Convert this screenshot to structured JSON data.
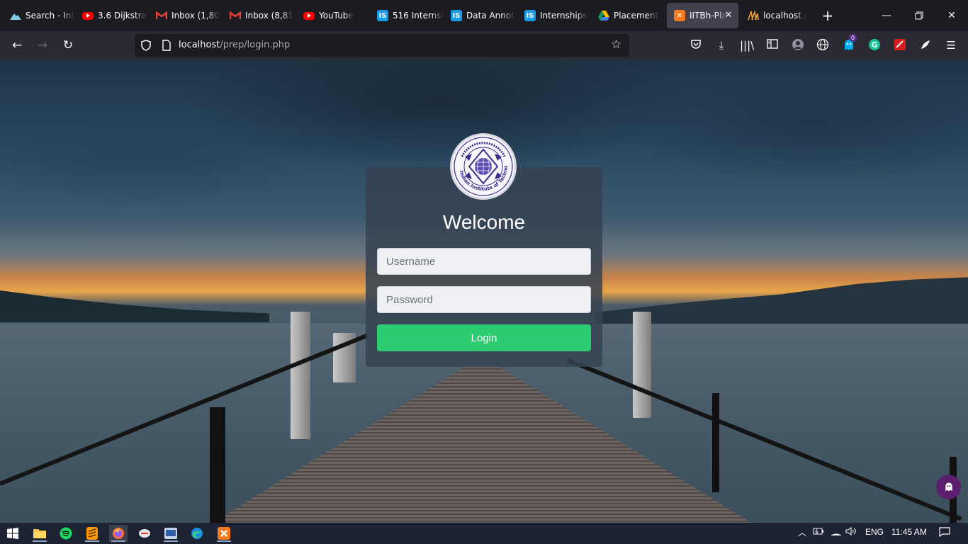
{
  "browser": {
    "tabs": [
      {
        "label": "Search - Int",
        "favicon": "search-engine-icon",
        "active": false
      },
      {
        "label": "3.6 Dijkstra",
        "favicon": "youtube-icon",
        "active": false
      },
      {
        "label": "Inbox (1,80",
        "favicon": "gmail-icon",
        "active": false
      },
      {
        "label": "Inbox (8,81",
        "favicon": "gmail-icon",
        "active": false
      },
      {
        "label": "YouTube",
        "favicon": "youtube-icon",
        "active": false
      },
      {
        "label": "516 Internsh",
        "favicon": "internshala-icon",
        "active": false
      },
      {
        "label": "Data Annot",
        "favicon": "internshala-icon",
        "active": false
      },
      {
        "label": "Internships",
        "favicon": "internshala-icon",
        "active": false
      },
      {
        "label": "Placement",
        "favicon": "google-drive-icon",
        "active": false
      },
      {
        "label": "IITBh-Pla",
        "favicon": "xampp-icon",
        "active": true
      },
      {
        "label": "localhost /",
        "favicon": "phpmyadmin-icon",
        "active": false
      }
    ],
    "url": {
      "host": "localhost",
      "path": "/prep/login.php"
    },
    "extension_badge": "0"
  },
  "page": {
    "logo_alt": "Indian Institute of Technology Bhilai",
    "logo_text": "Indian Institute of Technology Bhilai",
    "title": "Welcome",
    "username_placeholder": "Username",
    "password_placeholder": "Password",
    "login_label": "Login"
  },
  "taskbar": {
    "apps": [
      "windows-start",
      "file-explorer",
      "spotify",
      "sublime-text",
      "firefox",
      "app-5",
      "app-6",
      "edge",
      "xampp"
    ],
    "language": "ENG",
    "time": "11:45 AM"
  },
  "colors": {
    "login_button": "#2ecc71",
    "card_bg": "#364252",
    "tab_active": "#42414d"
  }
}
